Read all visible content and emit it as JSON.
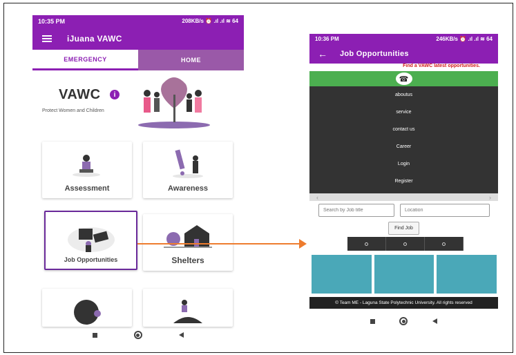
{
  "phone1": {
    "status": {
      "time": "10:35 PM",
      "right": "208KB/s ⏰ .ıl .ıl ≋ 64"
    },
    "app_title": "iJuana VAWC",
    "tabs": [
      "EMERGENCY",
      "HOME"
    ],
    "hero": {
      "title": "VAWC",
      "info_icon": "i",
      "tagline": "Protect Women and Children"
    },
    "cards": [
      "Assessment",
      "Awareness",
      "Job Opportunities",
      "Shelters"
    ]
  },
  "phone2": {
    "status": {
      "time": "10:36 PM",
      "right": "246KB/s ⏰ .ıl .ıl ≋ 64"
    },
    "app_title": "Job Opportunities",
    "back_icon": "←",
    "find_banner": "Find a VAWC latest opportunities.",
    "phone_icon": "☎",
    "menu": [
      "aboutus",
      "service",
      "contact us",
      "Career",
      "Login",
      "Register"
    ],
    "search": {
      "job_placeholder": "Search by Job title",
      "location_placeholder": "Location",
      "button": "Find Job"
    },
    "footer": "© Team ME - Laguna State Polytechnic University. All rights reserved"
  },
  "colors": {
    "primary": "#8c1fb3",
    "tab_inactive": "#9a59a8",
    "green": "#4caf50",
    "arrow": "#ee7c2e"
  }
}
